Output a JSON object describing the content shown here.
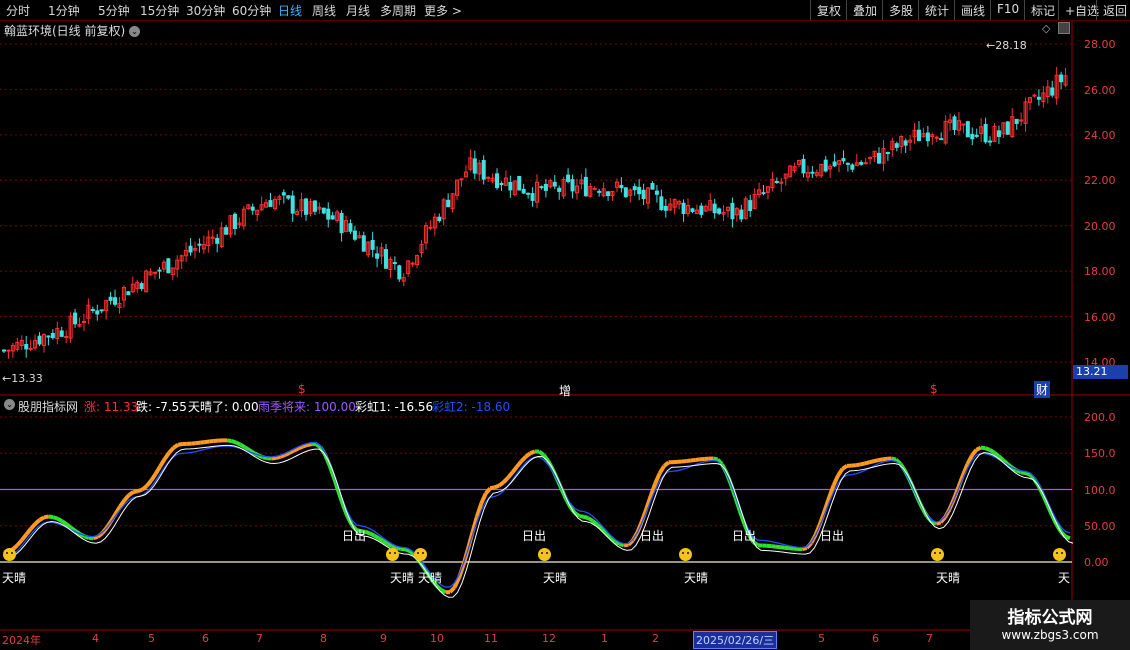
{
  "toolbar": {
    "periods": [
      "分时",
      "1分钟",
      "5分钟",
      "15分钟",
      "30分钟",
      "60分钟",
      "日线",
      "周线",
      "月线",
      "多周期",
      "更多 >"
    ],
    "active_period": "日线",
    "actions": [
      "复权",
      "叠加",
      "多股",
      "统计",
      "画线",
      "F10",
      "标记",
      "+自选",
      "返回"
    ]
  },
  "main_chart": {
    "title": "翰蓝环境(日线 前复权)",
    "high_label": "28.18",
    "low_label": "←13.33",
    "current_price": "13.21",
    "y_ticks": [
      "28.00",
      "26.00",
      "24.00",
      "22.00",
      "20.00",
      "18.00",
      "16.00",
      "14.00"
    ],
    "markers": [
      "$",
      "增",
      "$",
      "财"
    ]
  },
  "indicator": {
    "name": "股朋指标网",
    "items": [
      {
        "label": "涨: 11.33",
        "color": "#ff3030"
      },
      {
        "label": "跌: -7.55",
        "color": "#ffffff"
      },
      {
        "label": "天晴了: 0.00",
        "color": "#ffffff"
      },
      {
        "label": "雨季将来: 100.00",
        "color": "#9b59ff"
      },
      {
        "label": "彩虹1: -16.56",
        "color": "#ffffff"
      },
      {
        "label": "彩虹2: -18.60",
        "color": "#2050ff"
      }
    ],
    "y_ticks": [
      "200.0",
      "150.0",
      "100.0",
      "50.00",
      "0.00"
    ],
    "annotations": [
      "天晴",
      "日出",
      "天晴",
      "天晴",
      "日出",
      "天晴",
      "日出",
      "天晴",
      "日出",
      "日出",
      "天晴",
      "天"
    ]
  },
  "x_axis": {
    "labels": [
      "2024年",
      "4",
      "5",
      "6",
      "7",
      "8",
      "9",
      "10",
      "11",
      "12",
      "1",
      "2",
      "5",
      "6",
      "7"
    ],
    "selected_date": "2025/02/26/三"
  },
  "watermark": {
    "line1": "指标公式网",
    "line2": "www.zbgs3.com"
  },
  "chart_data": [
    {
      "type": "candlestick",
      "title": "翰蓝环境(日线 前复权)",
      "ylim": [
        13.2,
        28.4
      ],
      "x": [
        "2024-03",
        "2024-04",
        "2024-05",
        "2024-06",
        "2024-07",
        "2024-08",
        "2024-09",
        "2024-10",
        "2024-11",
        "2024-12",
        "2025-01",
        "2025-02",
        "2025-03",
        "2025-04",
        "2025-05",
        "2025-06",
        "2025-07"
      ],
      "close": [
        14.5,
        15.6,
        17.5,
        19.2,
        21.2,
        20.3,
        18.0,
        22.6,
        21.5,
        21.8,
        21.0,
        20.5,
        22.5,
        22.8,
        24.3,
        24.0,
        26.6
      ]
    },
    {
      "type": "line",
      "ylim": [
        -50,
        220
      ],
      "reference_lines": [
        0,
        100
      ],
      "series": [
        {
          "name": "彩虹1",
          "values": [
            10,
            60,
            30,
            95,
            160,
            165,
            140,
            160,
            40,
            15,
            -45,
            100,
            150,
            60,
            20,
            135,
            140,
            20,
            15,
            130,
            140,
            50,
            155,
            120,
            30
          ]
        },
        {
          "name": "彩虹2",
          "values": [
            5,
            55,
            35,
            90,
            150,
            160,
            145,
            165,
            50,
            20,
            -35,
            90,
            145,
            70,
            25,
            125,
            140,
            30,
            20,
            120,
            140,
            55,
            150,
            125,
            40
          ]
        }
      ]
    }
  ]
}
